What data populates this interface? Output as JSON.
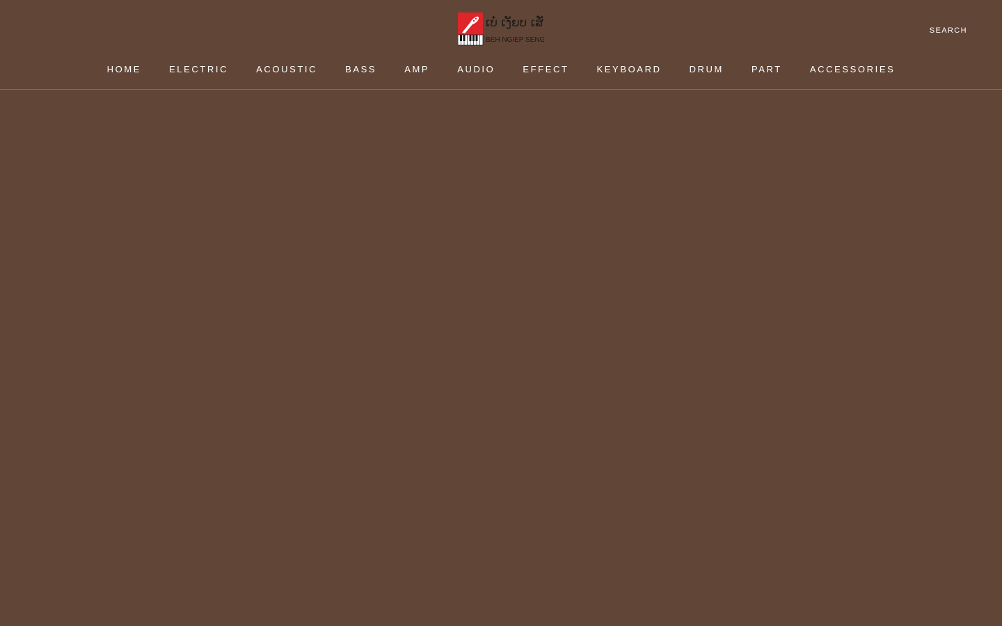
{
  "brand": {
    "name_lao": "ເບ໋ ເງັຍບ ເສັ່ງ",
    "name_latin": "BEH NGIEP SENG",
    "colors": {
      "background": "#614537",
      "logo_red": "#e0242b",
      "logo_text": "#1a1a1a",
      "nav_text": "#ffffff"
    }
  },
  "header": {
    "search_label": "SEARCH"
  },
  "nav": {
    "items": [
      {
        "label": "HOME"
      },
      {
        "label": "ELECTRIC"
      },
      {
        "label": "ACOUSTIC"
      },
      {
        "label": "BASS"
      },
      {
        "label": "AMP"
      },
      {
        "label": "AUDIO"
      },
      {
        "label": "EFFECT"
      },
      {
        "label": "KEYBOARD"
      },
      {
        "label": "DRUM"
      },
      {
        "label": "PART"
      },
      {
        "label": "ACCESSORIES"
      }
    ]
  }
}
